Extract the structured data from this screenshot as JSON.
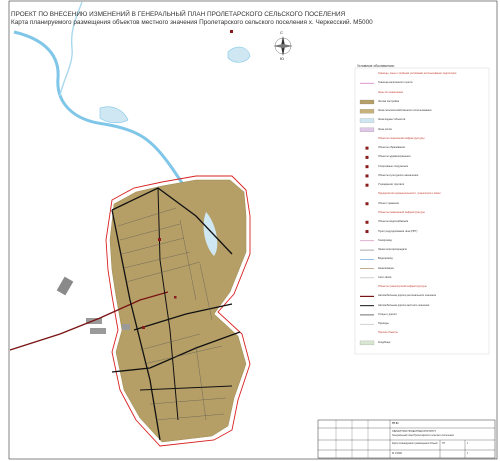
{
  "title": {
    "line1": "ПРОЕКТ ПО ВНЕСЕНИЮ ИЗМЕНЕНИЙ В ГЕНЕРАЛЬНЫЙ ПЛАН ПРОЛЕТАРСКОГО СЕЛЬСКОГО ПОСЕЛЕНИЯ",
    "line2": "Карта планируемого размещения объектов местного значения Пролетарского сельского поселения х. Черкесский. М5000"
  },
  "compass": {
    "n": "С",
    "s": "Ю",
    "w": "З",
    "e": "В"
  },
  "colors": {
    "settlement": "#b59f66",
    "water": "#cfe7f2",
    "river": "#7fc6e8",
    "border_red": "#d92020",
    "border_pink": "#d080c0",
    "road": "#111111",
    "road_regional": "#7a1414",
    "object": "#8b1a1a"
  },
  "legend": {
    "title": "Условные обозначения:",
    "items": [
      {
        "text": "Границы, зоны с особыми условиями использования территории",
        "red": true
      },
      {
        "text": "Граница населенного пункта",
        "red": false
      },
      {
        "text": "Зоны по назначению",
        "red": true
      },
      {
        "text": "Жилая застройка",
        "red": false
      },
      {
        "text": "Зона сельскохозяйственного использования",
        "red": false
      },
      {
        "text": "Зона водных объектов",
        "red": false
      },
      {
        "text": "Зона лесов",
        "red": false
      },
      {
        "text": "Объекты социальной инфраструктуры",
        "red": true
      },
      {
        "text": "Объекты образования",
        "red": false
      },
      {
        "text": "Объекты здравоохранения",
        "red": false
      },
      {
        "text": "Спортивные сооружения",
        "red": false
      },
      {
        "text": "Объекты культурного назначения",
        "red": false
      },
      {
        "text": "Учреждения торговли",
        "red": false
      },
      {
        "text": "Предприятия промышленности, транспорта и связи",
        "red": true
      },
      {
        "text": "Объект хранения",
        "red": false
      },
      {
        "text": "Объекты инженерной инфраструктуры",
        "red": true
      },
      {
        "text": "Объекты водоснабжения",
        "red": false
      },
      {
        "text": "Пункт редуцирования газа (ПРГ)",
        "red": false
      },
      {
        "text": "Газопровод",
        "red": false
      },
      {
        "text": "Линия электропередачи",
        "red": false
      },
      {
        "text": "Водопровод",
        "red": false
      },
      {
        "text": "Канализация",
        "red": false
      },
      {
        "text": "Сети связи",
        "red": false
      },
      {
        "text": "Объекты транспортной инфраструктуры",
        "red": true
      },
      {
        "text": "Автомобильная дорога регионального значения",
        "red": false
      },
      {
        "text": "Автомобильная дорога местного значения",
        "red": false
      },
      {
        "text": "Улицы и дороги",
        "red": false
      },
      {
        "text": "Проезды",
        "red": false
      },
      {
        "text": "Прочие объекты",
        "red": true
      },
      {
        "text": "Кладбище",
        "red": false
      }
    ]
  },
  "stamp": {
    "code": "ГП-01",
    "org": "ОБЛАСТНОЙ ПРОЕКТНЫЙ ИНСТИТУТ",
    "project": "Генеральный план Пролетарского сельского поселения",
    "sheet_title": "Карта планируемого размещения объектов местного значения",
    "scale": "М 1:5000",
    "stage": "ГП",
    "sheet": "1",
    "sheets": "1"
  }
}
